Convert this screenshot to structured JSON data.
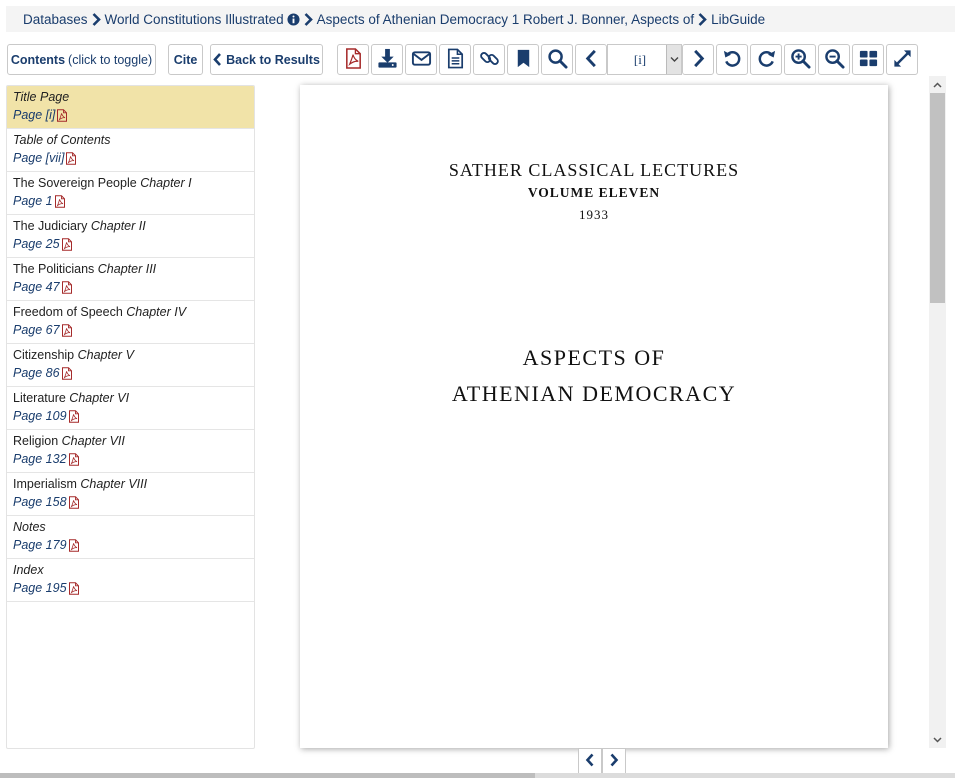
{
  "breadcrumb": {
    "items": [
      "Databases",
      "World Constitutions Illustrated",
      "Aspects of Athenian Democracy 1 Robert J. Bonner, Aspects of",
      "LibGuide"
    ]
  },
  "toolbar": {
    "contents_label": "Contents",
    "contents_hint": "(click to toggle)",
    "cite_label": "Cite",
    "back_label": "Back to Results",
    "page_value": "[i]"
  },
  "toc": {
    "items": [
      {
        "title": "",
        "subtitle": "Title Page",
        "page": "Page [i]"
      },
      {
        "title": "",
        "subtitle": "Table of Contents",
        "page": "Page [vii]"
      },
      {
        "title": "The Sovereign People",
        "subtitle": "Chapter I",
        "page": "Page 1"
      },
      {
        "title": "The Judiciary",
        "subtitle": "Chapter II",
        "page": "Page 25"
      },
      {
        "title": "The Politicians",
        "subtitle": "Chapter III",
        "page": "Page 47"
      },
      {
        "title": "Freedom of Speech",
        "subtitle": "Chapter IV",
        "page": "Page 67"
      },
      {
        "title": "Citizenship",
        "subtitle": "Chapter V",
        "page": "Page 86"
      },
      {
        "title": "Literature",
        "subtitle": "Chapter VI",
        "page": "Page 109"
      },
      {
        "title": "Religion",
        "subtitle": "Chapter VII",
        "page": "Page 132"
      },
      {
        "title": "Imperialism",
        "subtitle": "Chapter VIII",
        "page": "Page 158"
      },
      {
        "title": "",
        "subtitle": "Notes",
        "page": "Page 179"
      },
      {
        "title": "",
        "subtitle": "Index",
        "page": "Page 195"
      }
    ]
  },
  "document": {
    "series": "SATHER CLASSICAL LECTURES",
    "volume": "VOLUME ELEVEN",
    "year": "1933",
    "title_line1": "ASPECTS OF",
    "title_line2": "ATHENIAN DEMOCRACY"
  },
  "colors": {
    "link": "#1a3d6d",
    "pdf_red": "#a52a2a",
    "active_row": "#f1e3a8"
  }
}
